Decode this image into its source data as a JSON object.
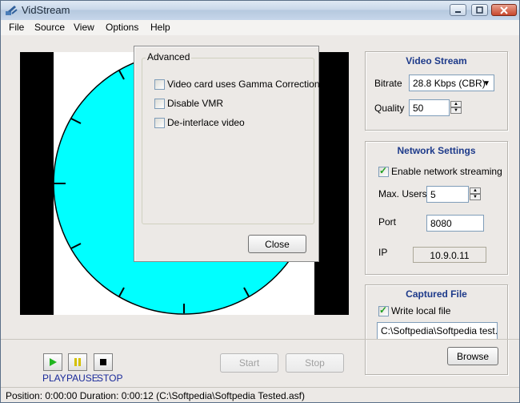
{
  "window": {
    "title": "VidStream"
  },
  "menu": [
    "File",
    "Source",
    "View",
    "Options",
    "Help"
  ],
  "colors": {
    "clock_face": "#00ffff",
    "panel_title": "#1d3a8a",
    "play_green": "#1fb51f",
    "pause_yellow": "#d4c000"
  },
  "advanced_dialog": {
    "group_label": "Advanced",
    "options": [
      {
        "label": "Video card uses Gamma Correction",
        "checked": false
      },
      {
        "label": "Disable VMR",
        "checked": false
      },
      {
        "label": "De-interlace video",
        "checked": false
      }
    ],
    "close_label": "Close"
  },
  "video_stream": {
    "title": "Video Stream",
    "bitrate_label": "Bitrate",
    "bitrate_value": "28.8 Kbps (CBR)",
    "quality_label": "Quality",
    "quality_value": "50"
  },
  "network_settings": {
    "title": "Network Settings",
    "enable_label": "Enable network streaming",
    "enable_checked": true,
    "max_users_label": "Max. Users",
    "max_users_value": "5",
    "port_label": "Port",
    "port_value": "8080",
    "ip_label": "IP",
    "ip_value": "10.9.0.11"
  },
  "captured_file": {
    "title": "Captured File",
    "write_label": "Write local file",
    "write_checked": true,
    "path_value": "C:\\Softpedia\\Softpedia test.asf",
    "browse_label": "Browse"
  },
  "transport": {
    "play_label": "PLAY",
    "pause_label": "PAUSE",
    "stop_label": "STOP",
    "start_button": "Start",
    "stop_button": "Stop"
  },
  "status": {
    "text": "Position: 0:00:00 Duration: 0:00:12  (C:\\Softpedia\\Softpedia Tested.asf)"
  }
}
